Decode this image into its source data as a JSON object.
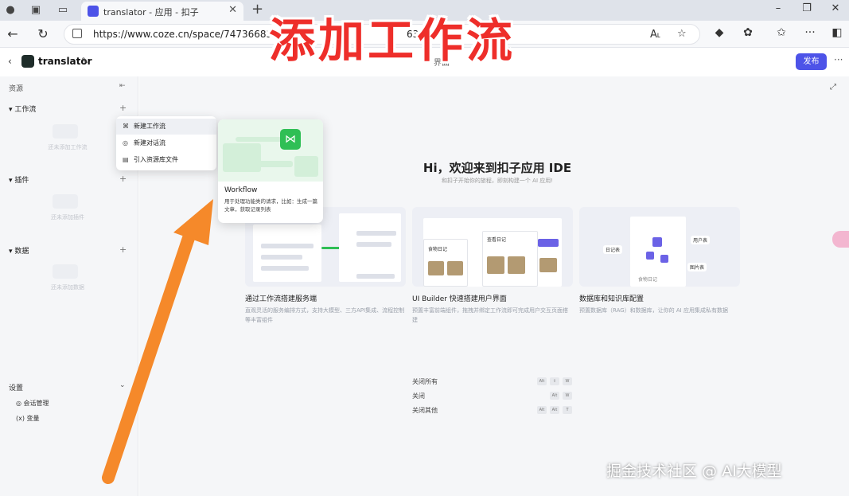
{
  "browser": {
    "tab_title": "translator - 应用 - 扣子",
    "tab_close": "✕",
    "new_tab": "+",
    "url": "https://www.coze.cn/space/74736683125",
    "url_tail": "63361",
    "read_aloud": "A˪"
  },
  "header": {
    "app_name": "translator",
    "mode_label": "界面",
    "publish_label": "发布",
    "more": "···"
  },
  "sidebar": {
    "title": "资源",
    "groups": [
      {
        "label": "工作流",
        "empty": "还未添加工作流"
      },
      {
        "label": "插件",
        "empty": "还未添加插件"
      },
      {
        "label": "数据",
        "empty": "还未添加数据"
      }
    ],
    "settings": {
      "label": "设置",
      "items": [
        {
          "icon": "◎",
          "label": "会话管理"
        },
        {
          "icon": "(x)",
          "label": "变量"
        }
      ]
    }
  },
  "menu": {
    "items": [
      {
        "icon": "⌘",
        "label": "新建工作流"
      },
      {
        "icon": "◎",
        "label": "新建对话流"
      },
      {
        "icon": "▤",
        "label": "引入资源库文件"
      }
    ]
  },
  "workflow_card": {
    "title": "Workflow",
    "description": "用于处理功能类的请求，比如：生成一篇文章，获取记录列表"
  },
  "main": {
    "hero_title": "Hi，欢迎来到扣子应用 IDE",
    "hero_subtitle": "和扣子开始你的旅程，即刻构建一个 AI 应用!",
    "features": [
      {
        "title": "通过工作流搭建服务端",
        "desc": "直观灵活的服务编排方式，支持大模型、三方API集成、流程控制等丰富组件"
      },
      {
        "title": "UI Builder 快速搭建用户界面",
        "desc": "预置丰富前端组件，拖拽并绑定工作流即可完成用户交互页面搭建"
      },
      {
        "title": "数据库和知识库配置",
        "desc": "预置数据库（RAG）和数据库，让你的 AI 应用集成私有数据"
      }
    ],
    "feature_tags": {
      "ui_card": "查看日记",
      "ui_label": "食物日记",
      "db_a": "日记表",
      "db_b": "图片表",
      "db_c": "用户表",
      "db_d": "食物日记"
    },
    "shortcuts": [
      {
        "label": "关闭所有",
        "keys": [
          "Alt",
          "⇧",
          "W"
        ]
      },
      {
        "label": "关闭",
        "keys": [
          "Alt",
          "W"
        ]
      },
      {
        "label": "关闭其他",
        "keys": [
          "Alt",
          "Alt",
          "T"
        ]
      }
    ]
  },
  "overlay": {
    "title": "添加工作流",
    "watermark": "掘金技术社区 @ AI大模型"
  },
  "colors": {
    "accent": "#4d53e8",
    "overlay_red": "#ee2e2a",
    "arrow_orange": "#f5892a",
    "workflow_green": "#2fbf55"
  }
}
